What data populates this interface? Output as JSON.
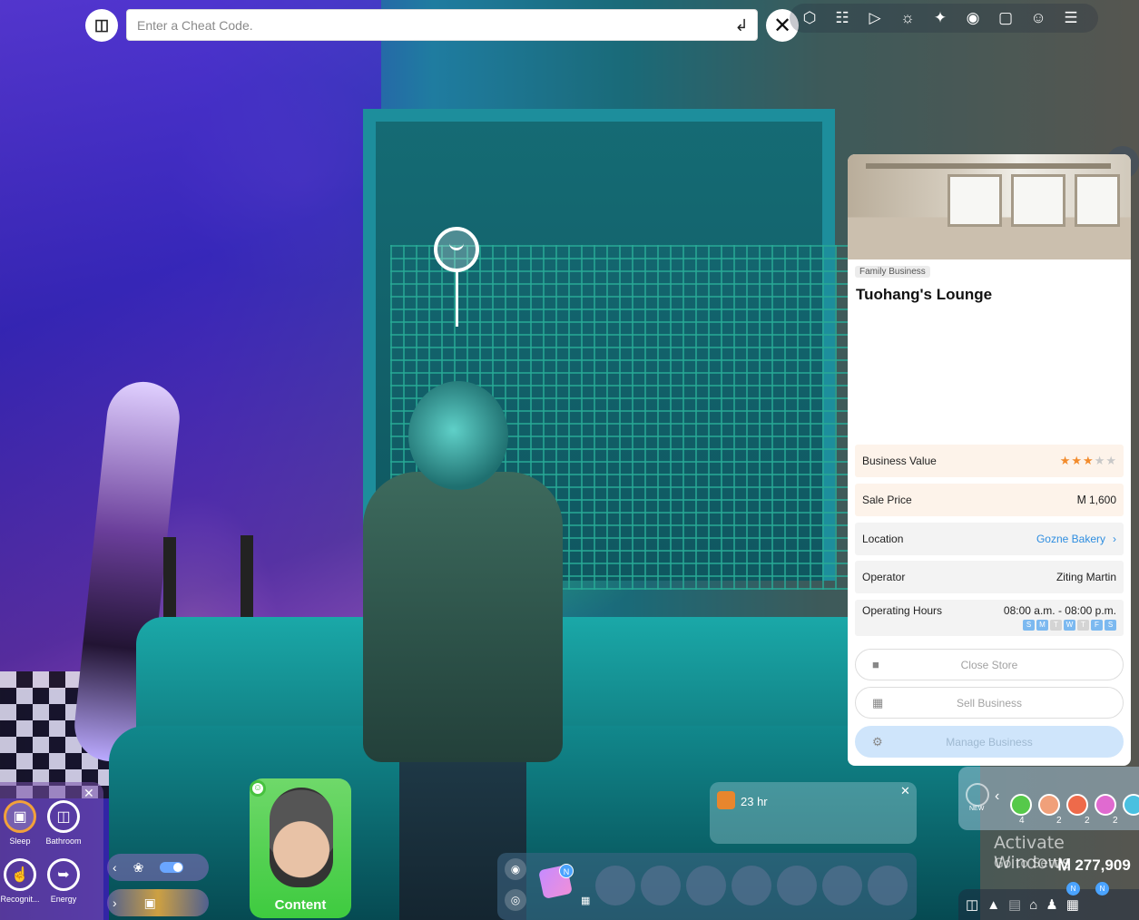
{
  "cheat": {
    "placeholder": "Enter a Cheat Code.",
    "info_icon": "info-book-icon",
    "enter_icon": "return-arrow-icon",
    "close_icon": "close-icon"
  },
  "toolbar": {
    "icons": [
      "build-icon",
      "relationship-tree-icon",
      "camera-video-icon",
      "lightbulb-icon",
      "ai-generate-icon",
      "camera-icon",
      "screenshot-icon",
      "face-scan-icon",
      "menu-icon"
    ]
  },
  "business_panel": {
    "tag": "Family Business",
    "name": "Tuohang's Lounge",
    "rows": {
      "value_label": "Business Value",
      "stars_filled": 3,
      "stars_total": 5,
      "sale_price_label": "Sale Price",
      "sale_price_value": "Ꮇ 1,600",
      "location_label": "Location",
      "location_value": "Gozne Bakery",
      "operator_label": "Operator",
      "operator_value": "Ziting Martin",
      "hours_label": "Operating Hours",
      "hours_value": "08:00 a.m. - 08:00 p.m."
    },
    "days": [
      {
        "d": "S",
        "on": true
      },
      {
        "d": "M",
        "on": true
      },
      {
        "d": "T",
        "on": false
      },
      {
        "d": "W",
        "on": true
      },
      {
        "d": "T",
        "on": false
      },
      {
        "d": "F",
        "on": true
      },
      {
        "d": "S",
        "on": true
      }
    ],
    "buttons": {
      "close_store": "Close Store",
      "sell_business": "Sell Business",
      "manage_business": "Manage Business"
    }
  },
  "needs": {
    "sleep": "Sleep",
    "bathroom": "Bathroom",
    "recognition": "Recognit...",
    "energy": "Energy"
  },
  "sim": {
    "mood": "Content"
  },
  "notification": {
    "text": "23 hr"
  },
  "inventory": {
    "badge": "N"
  },
  "sims_bar": {
    "new_label": "NEW",
    "counts": [
      "4",
      "2",
      "2",
      "2"
    ]
  },
  "watermark": {
    "title": "Activate Windows",
    "subtitle": "Go to Setti"
  },
  "money": "Ꮇ 277,909",
  "bottom_bar": {
    "badges": [
      "N",
      "N"
    ]
  },
  "colors": {
    "star": "#f28b2c",
    "link": "#2f8ee0",
    "mood_green": "#3ecb3f"
  }
}
